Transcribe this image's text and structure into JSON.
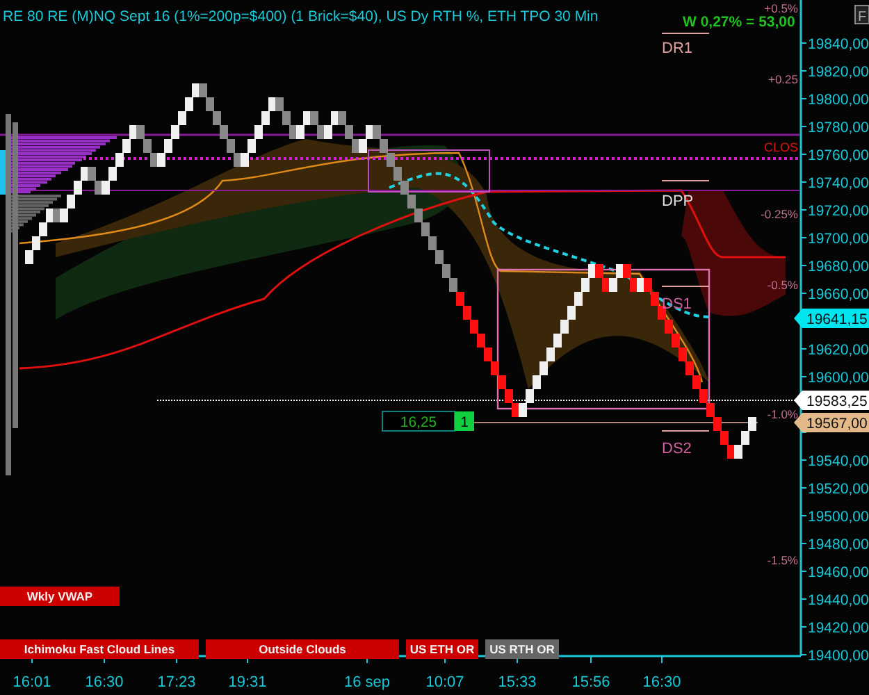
{
  "title": "RE 80 RE (M)NQ Sept 16 (1%=200p=$400) (1 Brick=$40), US Dy RTH %, ETH TPO 30 Min",
  "weekly_change": "W 0,27% = 53,00",
  "corner_button": "F",
  "price_axis_upper": [
    "19840,00",
    "19820,00",
    "19800,00",
    "19780,00",
    "19760,00",
    "19740,00",
    "19720,00",
    "19700,00",
    "19680,00",
    "19660,00"
  ],
  "price_axis_middle": [
    "19620,00",
    "19600,00"
  ],
  "price_axis_lower": [
    "19540,00",
    "19520,00",
    "19500,00",
    "19480,00",
    "19460,00",
    "19440,00",
    "19420,00",
    "19400,00"
  ],
  "time_axis": [
    "16:01",
    "16:30",
    "17:23",
    "19:31",
    "16 sep",
    "10:07",
    "15:33",
    "15:56",
    "16:30"
  ],
  "price_tags": [
    {
      "text": "19641,15",
      "color": "#00e5ee"
    },
    {
      "text": "19583,25",
      "color": "#ffffff"
    },
    {
      "text": "19567,00",
      "color": "#e3b98a"
    }
  ],
  "pivot_labels": [
    "DR1",
    "DPP",
    "DS1",
    "DS2"
  ],
  "percent_labels": [
    "+0.5%",
    "+0.25",
    "-0.25%",
    "-0.5%",
    "-1.0%",
    "-1.5%"
  ],
  "close_label": "CLOS",
  "range_box": {
    "value": "16,25",
    "count": "1"
  },
  "toggle_buttons": [
    {
      "label": "Wkly VWAP",
      "on": true
    },
    {
      "label": "Ichimoku Fast Cloud Lines",
      "on": true
    },
    {
      "label": "Outside Clouds",
      "on": true
    },
    {
      "label": "US ETH OR",
      "on": true
    },
    {
      "label": "US RTH OR",
      "on": false
    }
  ]
}
